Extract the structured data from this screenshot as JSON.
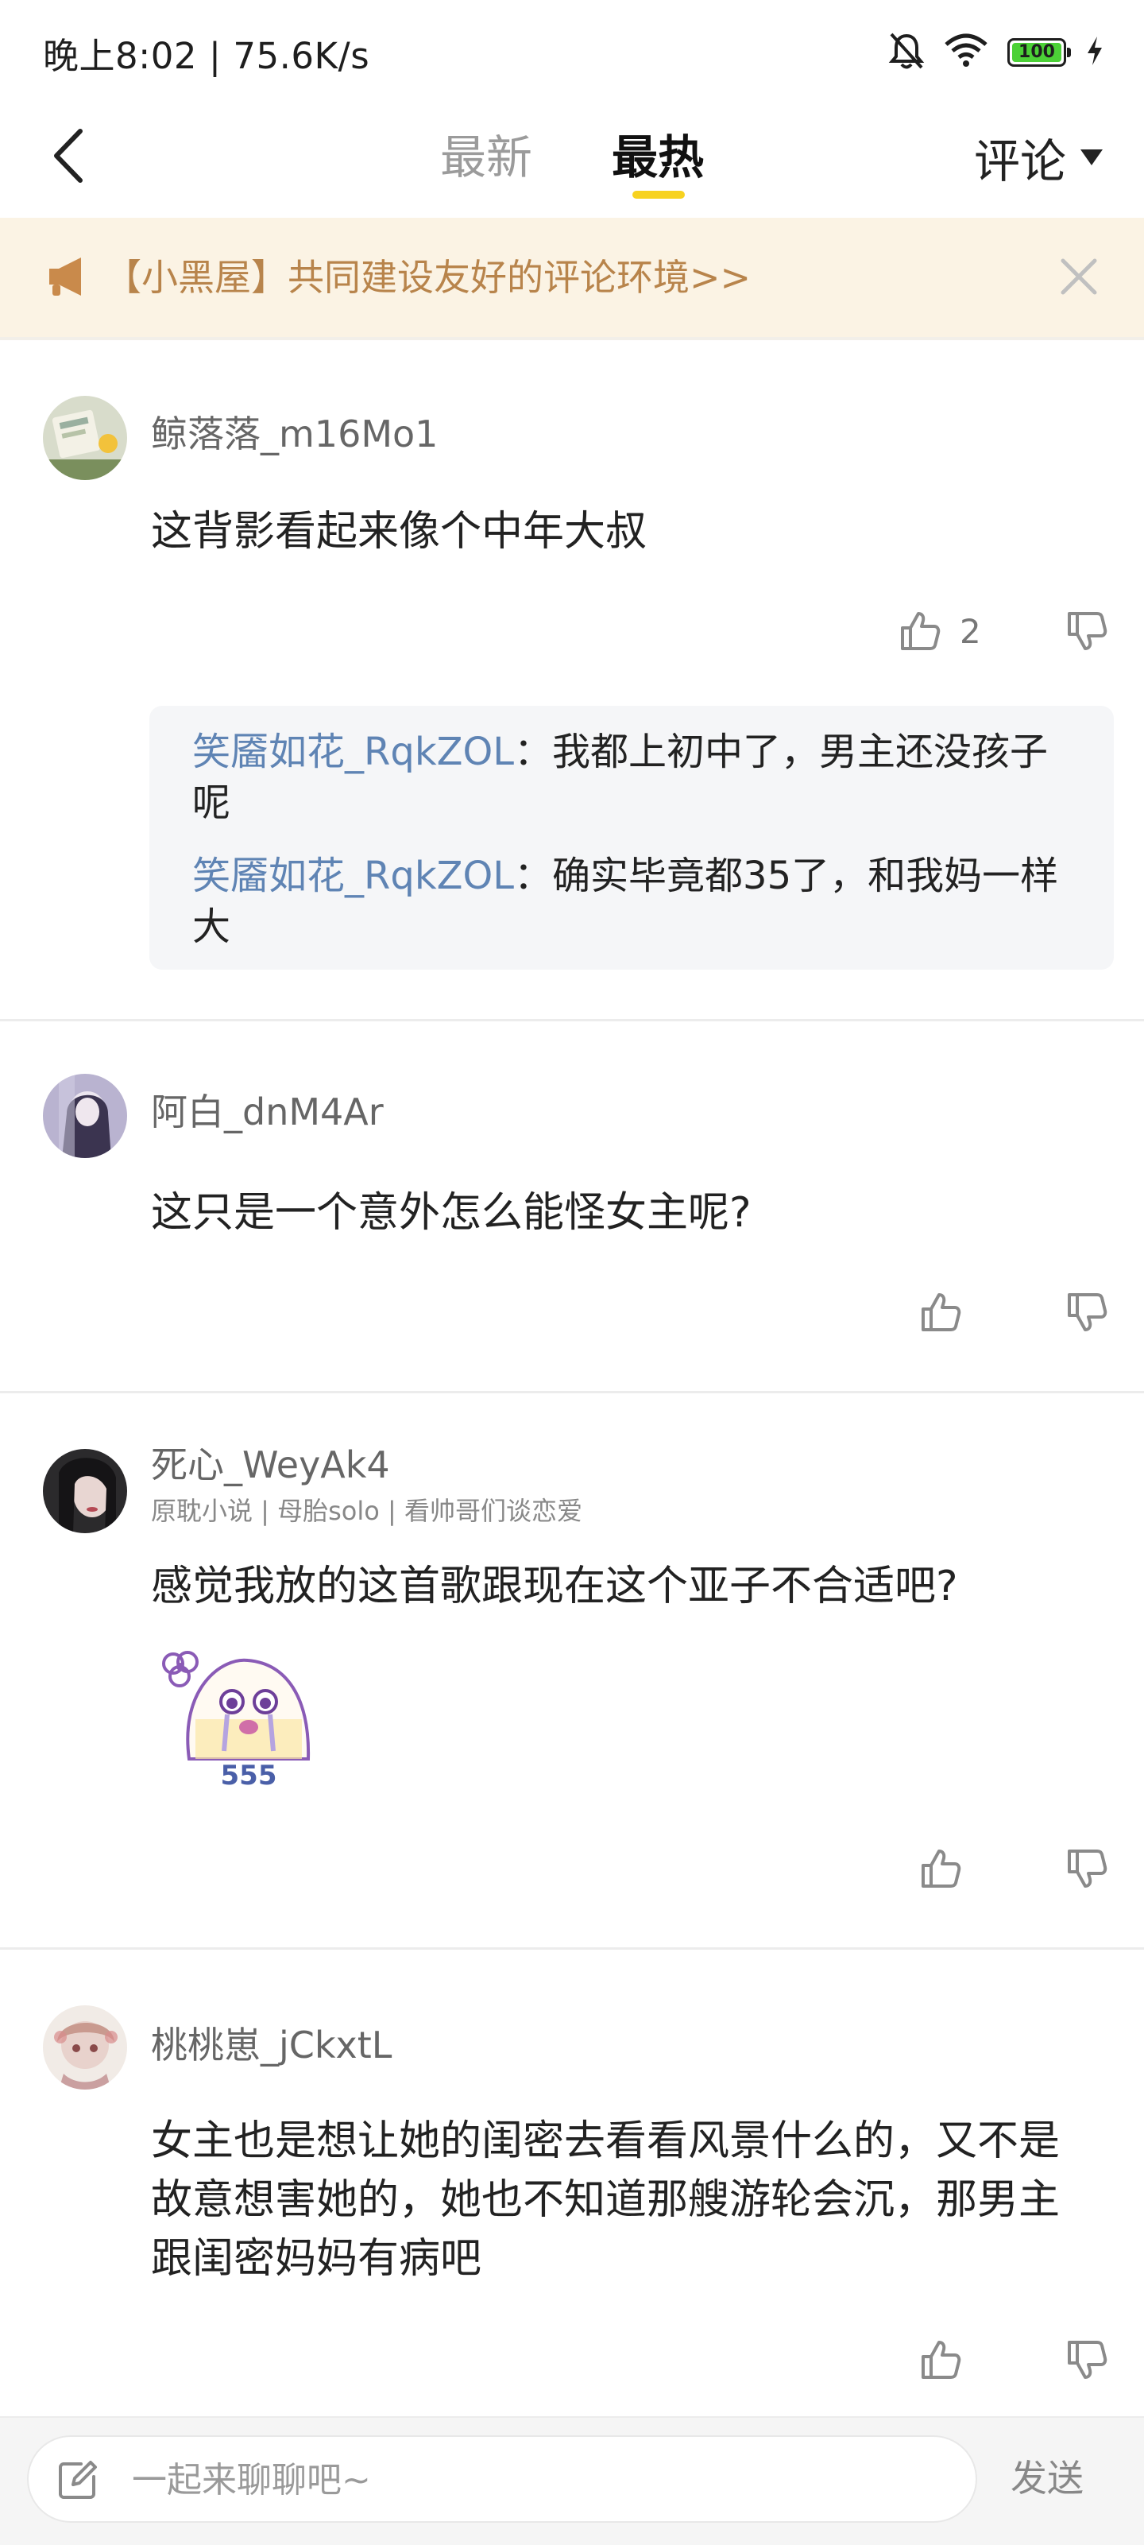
{
  "status_bar": {
    "time_speed": "晚上8:02 | 75.6K/s",
    "battery": "100",
    "icons": [
      "mute-bell-icon",
      "wifi-icon",
      "battery-icon",
      "charging-icon"
    ]
  },
  "nav": {
    "tabs": [
      {
        "label": "最新",
        "active": false
      },
      {
        "label": "最热",
        "active": true
      }
    ],
    "sort_label": "评论",
    "accent_color": "#f7d21f"
  },
  "notice": {
    "text": "【小黑屋】共同建设友好的评论环境>>",
    "text_color": "#b8844b",
    "background": "#fbf3e4"
  },
  "comments": [
    {
      "username": "鲸落落_m16Mo1",
      "text": "这背影看起来像个中年大叔",
      "likes": "2",
      "replies": [
        {
          "author": "笑靥如花_RqkZOL",
          "separator": "：",
          "text": "我都上初中了，男主还没孩子呢"
        },
        {
          "author": "笑靥如花_RqkZOL",
          "separator": "：",
          "text": "确实毕竟都35了，和我妈一样大"
        }
      ]
    },
    {
      "username": "阿白_dnM4Ar",
      "text": "这只是一个意外怎么能怪女主呢?"
    },
    {
      "username": "死心_WeyAk4",
      "tags": "原耽小说 | 母胎solo | 看帅哥们谈恋爱",
      "text": "感觉我放的这首歌跟现在这个亚子不合适吧?",
      "sticker_text": "555"
    },
    {
      "username": "桃桃崽_jCkxtL",
      "text": "女主也是想让她的闺密去看看风景什么的，又不是故意想害她的，她也不知道那艘游轮会沉，那男主跟闺密妈妈有病吧"
    }
  ],
  "composer": {
    "placeholder": "一起来聊聊吧~",
    "value": "",
    "send_label": "发送"
  }
}
